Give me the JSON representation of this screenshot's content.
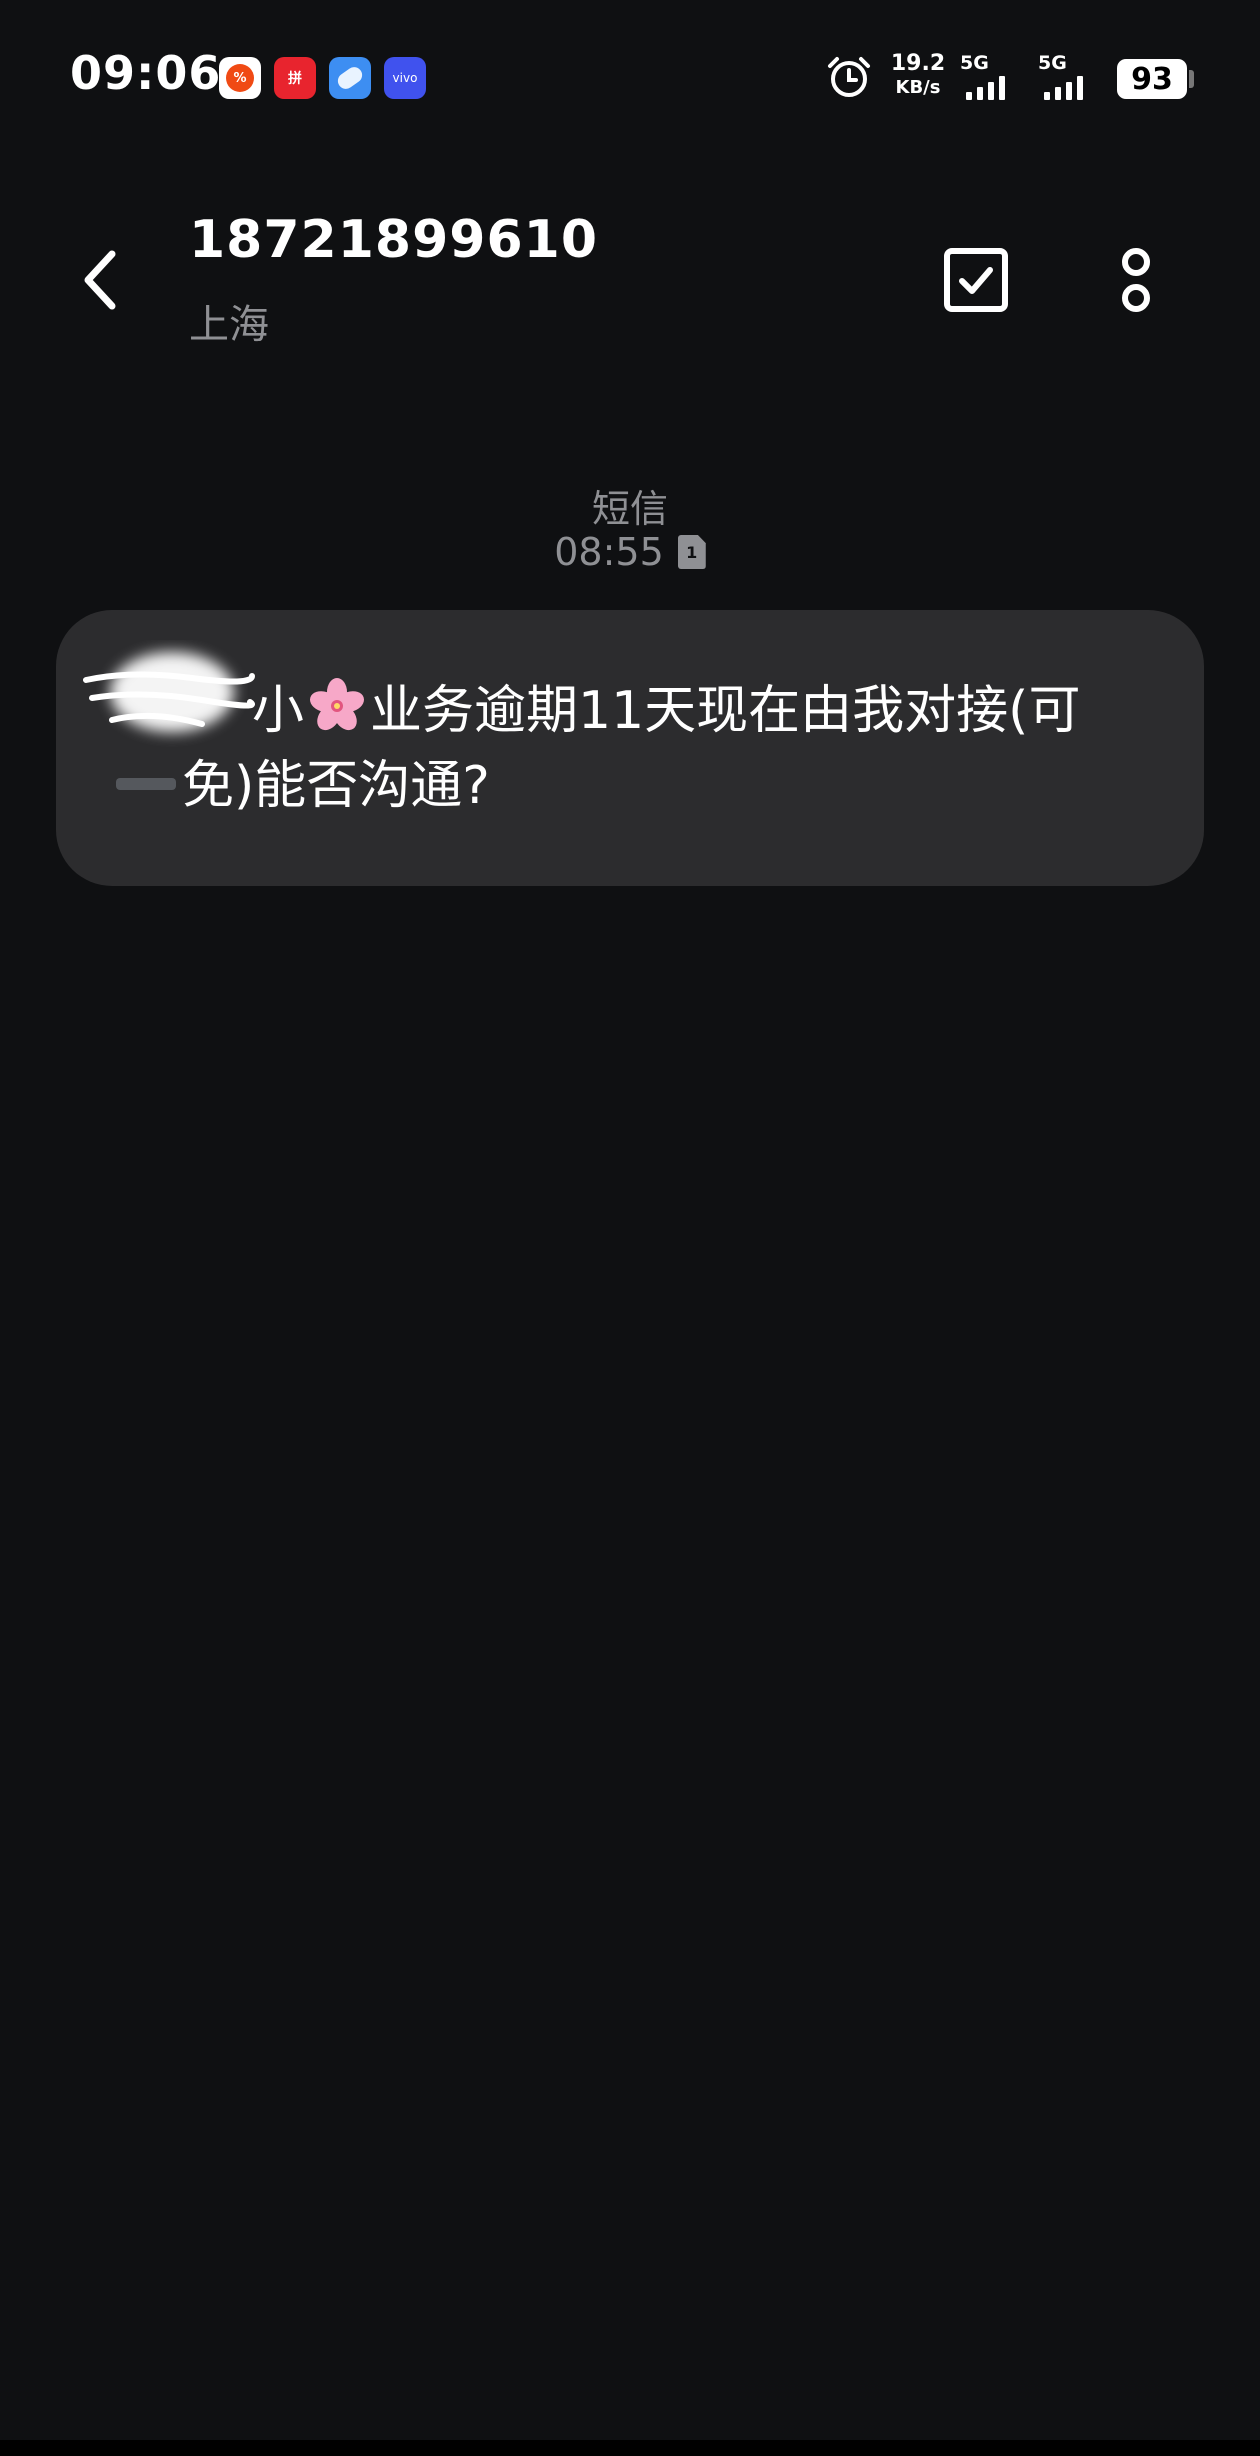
{
  "status_bar": {
    "time": "09:06",
    "app_icons": [
      "kuaishou-icon",
      "pinduoduo-icon",
      "browser-icon",
      "vivo-icon"
    ],
    "vivo_label": "vivo",
    "app2_label": "拼",
    "app1_label": "%",
    "alarm_icon": "alarm-clock-icon",
    "speed_value": "19.2",
    "speed_unit": "KB/s",
    "signal1_label": "5G",
    "signal2_label": "5G",
    "battery": "93"
  },
  "header": {
    "back_icon": "chevron-left-icon",
    "contact_number": "18721899610",
    "contact_location": "上海",
    "select_icon": "checkbox-icon",
    "more_icon": "more-vertical-icon"
  },
  "message": {
    "type_label": "短信",
    "time": "08:55",
    "sim_label": "1",
    "line1_a": "小",
    "emoji": "🌸",
    "line1_b": "业务逾期11天现在由我对接(可",
    "line2": "免)能否沟通?",
    "bubble_color": "#2c2c2e"
  },
  "colors": {
    "background": "#0f1012",
    "secondary_text": "#8f9094",
    "primary_text": "#ffffff"
  }
}
